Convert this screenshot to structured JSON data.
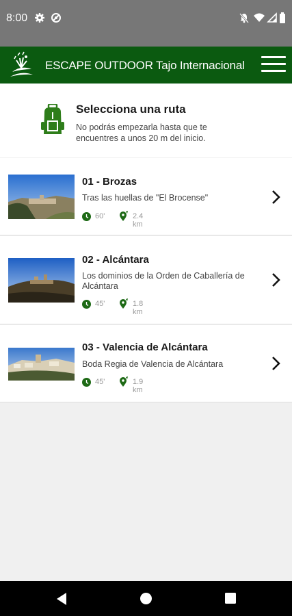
{
  "status_bar": {
    "time": "8:00",
    "icons_left": [
      "gear-icon",
      "sync-icon"
    ],
    "icons_right": [
      "notifications-off-icon",
      "wifi-icon",
      "signal-icon",
      "battery-icon"
    ]
  },
  "app_bar": {
    "title": "ESCAPE OUTDOOR Tajo Internacional",
    "logo": "escape-outdoor-logo",
    "menu_icon": "hamburger-menu-icon",
    "color": "#0b5a10"
  },
  "header": {
    "icon": "backpack-icon",
    "title": "Selecciona una ruta",
    "subtitle": "No podrás empezarla hasta que te encuentres a unos 20 m del inicio."
  },
  "routes": [
    {
      "title": "01 - Brozas",
      "description": "Tras las huellas de \"El Brocense\"",
      "duration": "60'",
      "distance": "2.4 km"
    },
    {
      "title": "02 - Alcántara",
      "description": "Los dominios de la Orden de Caballería de Alcántara",
      "duration": "45'",
      "distance": "1.8 km"
    },
    {
      "title": "03 - Valencia de Alcántara",
      "description": "Boda Regia de Valencia de Alcántara",
      "duration": "45'",
      "distance": "1.9 km"
    }
  ],
  "nav_bar": {
    "buttons": [
      "back-icon",
      "home-icon",
      "recents-icon"
    ]
  },
  "colors": {
    "primary_green": "#0b5a10",
    "status_bar": "#777777",
    "background": "#f0f0f0"
  }
}
